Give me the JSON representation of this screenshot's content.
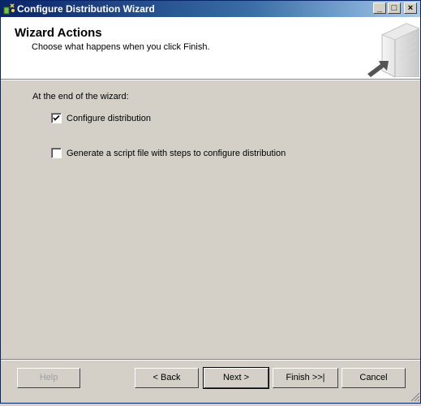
{
  "window": {
    "title": "Configure Distribution Wizard",
    "minimize_label": "_",
    "maximize_label": "□",
    "close_label": "×"
  },
  "header": {
    "title": "Wizard Actions",
    "subtitle": "Choose what happens when you click Finish."
  },
  "main": {
    "section_label": "At the end of the wizard:",
    "options": [
      {
        "label": "Configure distribution",
        "checked": true
      },
      {
        "label": "Generate a script file with steps to configure distribution",
        "checked": false
      }
    ]
  },
  "footer": {
    "help_label": "Help",
    "back_label": "< Back",
    "next_label": "Next >",
    "finish_label": "Finish >>|",
    "cancel_label": "Cancel"
  },
  "colors": {
    "titlebar_start": "#0a246a",
    "titlebar_end": "#a6caf0",
    "dialog_bg": "#d4d0c8",
    "header_bg": "#ffffff"
  }
}
